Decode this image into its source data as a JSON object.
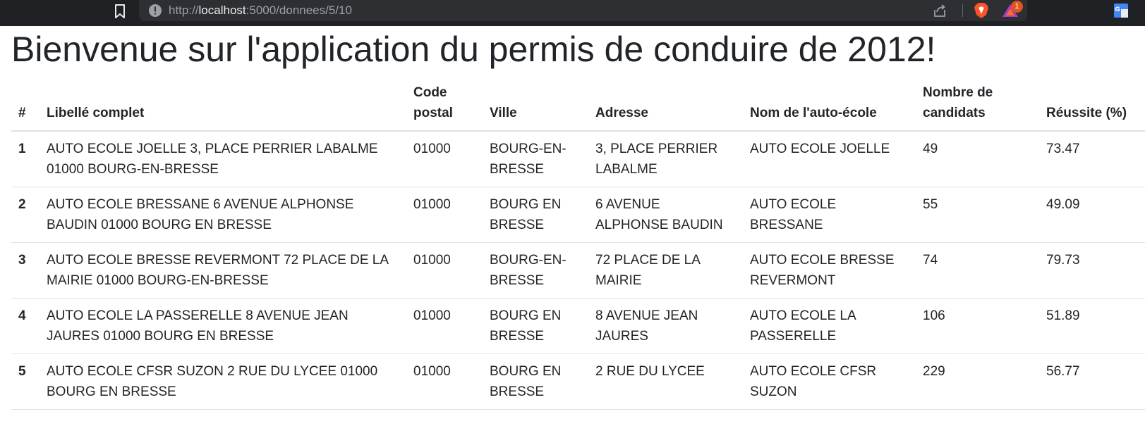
{
  "browser": {
    "url_scheme": "http://",
    "url_host": "localhost",
    "url_rest": ":5000/donnees/5/10",
    "rewards_badge_count": "1"
  },
  "page": {
    "title": "Bienvenue sur l'application du permis de conduire de 2012!"
  },
  "table": {
    "headers": {
      "num": "#",
      "libelle": "Libellé complet",
      "code_postal": "Code postal",
      "ville": "Ville",
      "adresse": "Adresse",
      "nom": "Nom de l'auto-école",
      "candidats": "Nombre de candidats",
      "reussite": "Réussite (%)"
    },
    "rows": [
      {
        "num": "1",
        "libelle": "AUTO ECOLE JOELLE 3, PLACE PERRIER LABALME 01000 BOURG-EN-BRESSE",
        "code_postal": "01000",
        "ville": "BOURG-EN-BRESSE",
        "adresse": "3, PLACE PERRIER LABALME",
        "nom": "AUTO ECOLE JOELLE",
        "candidats": "49",
        "reussite": "73.47"
      },
      {
        "num": "2",
        "libelle": "AUTO ECOLE BRESSANE 6 AVENUE ALPHONSE BAUDIN 01000 BOURG EN BRESSE",
        "code_postal": "01000",
        "ville": "BOURG EN BRESSE",
        "adresse": "6 AVENUE ALPHONSE BAUDIN",
        "nom": "AUTO ECOLE BRESSANE",
        "candidats": "55",
        "reussite": "49.09"
      },
      {
        "num": "3",
        "libelle": "AUTO ECOLE BRESSE REVERMONT 72 PLACE DE LA MAIRIE 01000 BOURG-EN-BRESSE",
        "code_postal": "01000",
        "ville": "BOURG-EN-BRESSE",
        "adresse": "72 PLACE DE LA MAIRIE",
        "nom": "AUTO ECOLE BRESSE REVERMONT",
        "candidats": "74",
        "reussite": "79.73"
      },
      {
        "num": "4",
        "libelle": "AUTO ECOLE LA PASSERELLE 8 AVENUE JEAN JAURES 01000 BOURG EN BRESSE",
        "code_postal": "01000",
        "ville": "BOURG EN BRESSE",
        "adresse": "8 AVENUE JEAN JAURES",
        "nom": "AUTO ECOLE LA PASSERELLE",
        "candidats": "106",
        "reussite": "51.89"
      },
      {
        "num": "5",
        "libelle": "AUTO ECOLE CFSR SUZON 2 RUE DU LYCEE 01000 BOURG EN BRESSE",
        "code_postal": "01000",
        "ville": "BOURG EN BRESSE",
        "adresse": "2 RUE DU LYCEE",
        "nom": "AUTO ECOLE CFSR SUZON",
        "candidats": "229",
        "reussite": "56.77"
      }
    ]
  }
}
